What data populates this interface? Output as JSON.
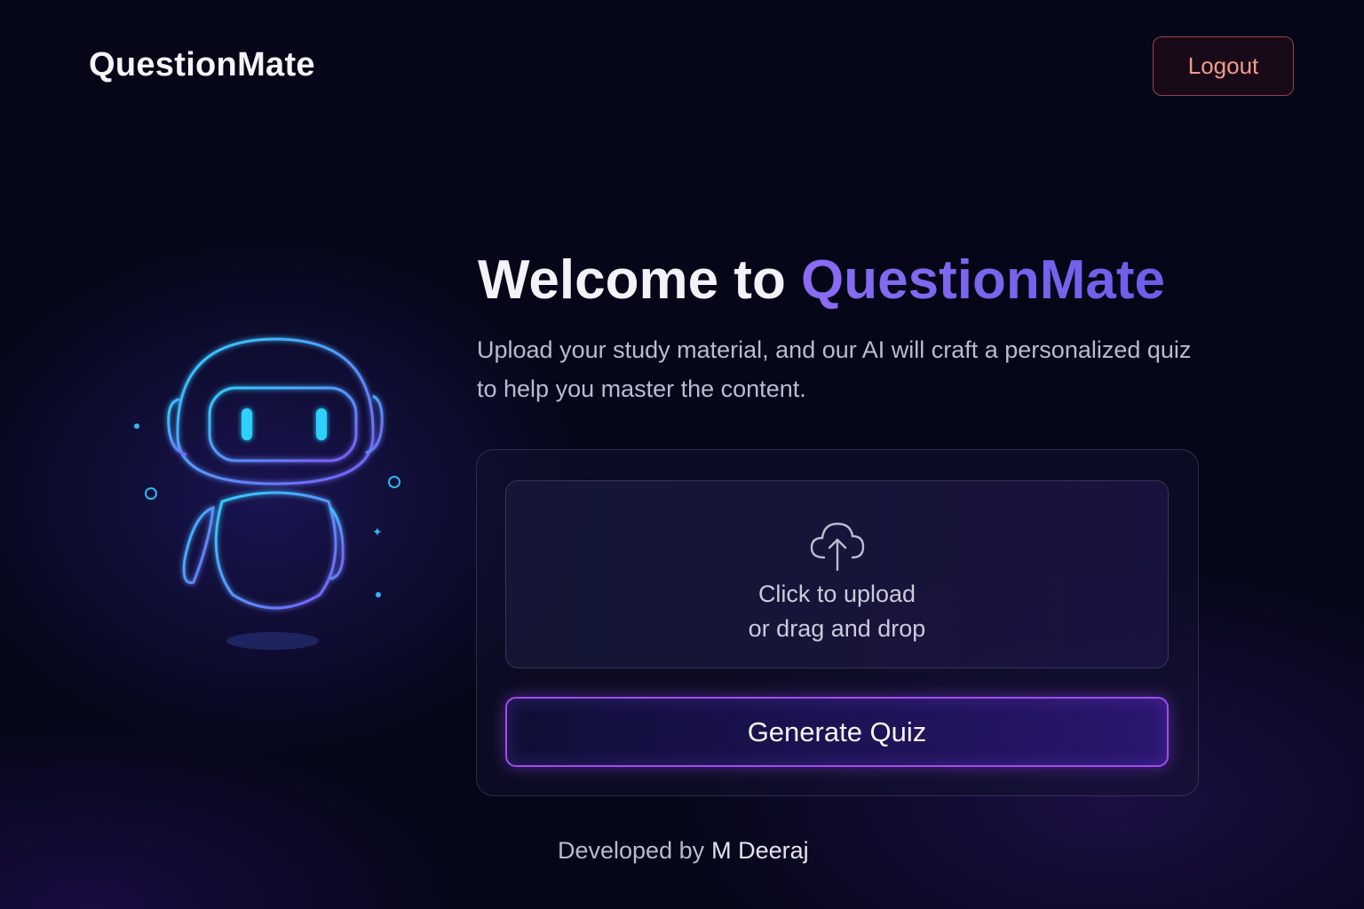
{
  "header": {
    "brand": "QuestionMate",
    "logout_label": "Logout"
  },
  "hero": {
    "title_prefix": "Welcome to ",
    "title_accent": "QuestionMate",
    "subtitle": "Upload your study material, and our AI will craft a personalized quiz to help you master the content."
  },
  "upload": {
    "line1": "Click to upload",
    "line2": "or drag and drop",
    "icon": "cloud-upload-icon"
  },
  "actions": {
    "generate_label": "Generate Quiz"
  },
  "footer": {
    "prefix": "Developed by",
    "author": "M Deeraj"
  },
  "illustration": {
    "icon": "robot-icon"
  },
  "colors": {
    "background": "#050718",
    "accent": "#7b63ee",
    "logout": "#f09a8a",
    "button_border": "#a24cf0",
    "robot_cyan": "#2fd0ff"
  }
}
